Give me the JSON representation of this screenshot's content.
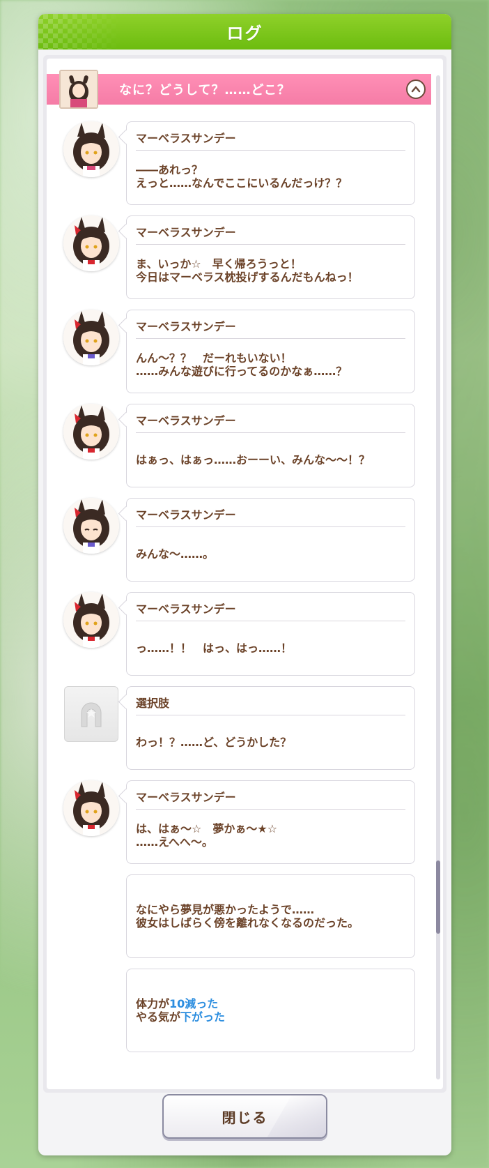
{
  "header": {
    "title": "ログ"
  },
  "chapter": {
    "title": "なに？どうして？……どこ？"
  },
  "speaker_name": "マーベラスサンデー",
  "entries": [
    {
      "kind": "speaker",
      "name": "マーベラスサンデー",
      "lines": [
        "――あれっ？",
        "えっと……なんでここにいるんだっけ？？"
      ]
    },
    {
      "kind": "speaker",
      "name": "マーベラスサンデー",
      "lines": [
        "ま、いっか☆　早く帰ろうっと！",
        "今日はマーベラス枕投げするんだもんねっ！"
      ]
    },
    {
      "kind": "speaker",
      "name": "マーベラスサンデー",
      "lines": [
        "んん～？？　だーれもいない！",
        "……みんな遊びに行ってるのかなぁ……？"
      ]
    },
    {
      "kind": "speaker",
      "name": "マーベラスサンデー",
      "lines": [
        "はぁっ、はぁっ……おーーい、みんな～～！？"
      ]
    },
    {
      "kind": "speaker",
      "name": "マーベラスサンデー",
      "lines": [
        "みんな～……。"
      ]
    },
    {
      "kind": "speaker",
      "name": "マーベラスサンデー",
      "lines": [
        "っ……！！　はっ、はっ……！"
      ]
    },
    {
      "kind": "choice",
      "name": "選択肢",
      "lines": [
        "わっ！？……ど、どうかした？"
      ]
    },
    {
      "kind": "speaker",
      "name": "マーベラスサンデー",
      "lines": [
        "は、はぁ～☆　夢かぁ～★☆",
        "……えへへ～。"
      ]
    },
    {
      "kind": "narration",
      "lines": [
        "なにやら夢見が悪かったようで……",
        "彼女はしばらく傍を離れなくなるのだった。"
      ]
    }
  ],
  "result": {
    "line1_prefix": "体力が",
    "line1_value": "10減った",
    "line2_prefix": "やる気が",
    "line2_value": "下がった"
  },
  "close_button": {
    "label": "閉じる"
  },
  "colors": {
    "header_green": "#7dc61c",
    "chapter_pink": "#f57ca6",
    "text_brown": "#6b4228",
    "highlight_blue": "#2b8ddf"
  }
}
